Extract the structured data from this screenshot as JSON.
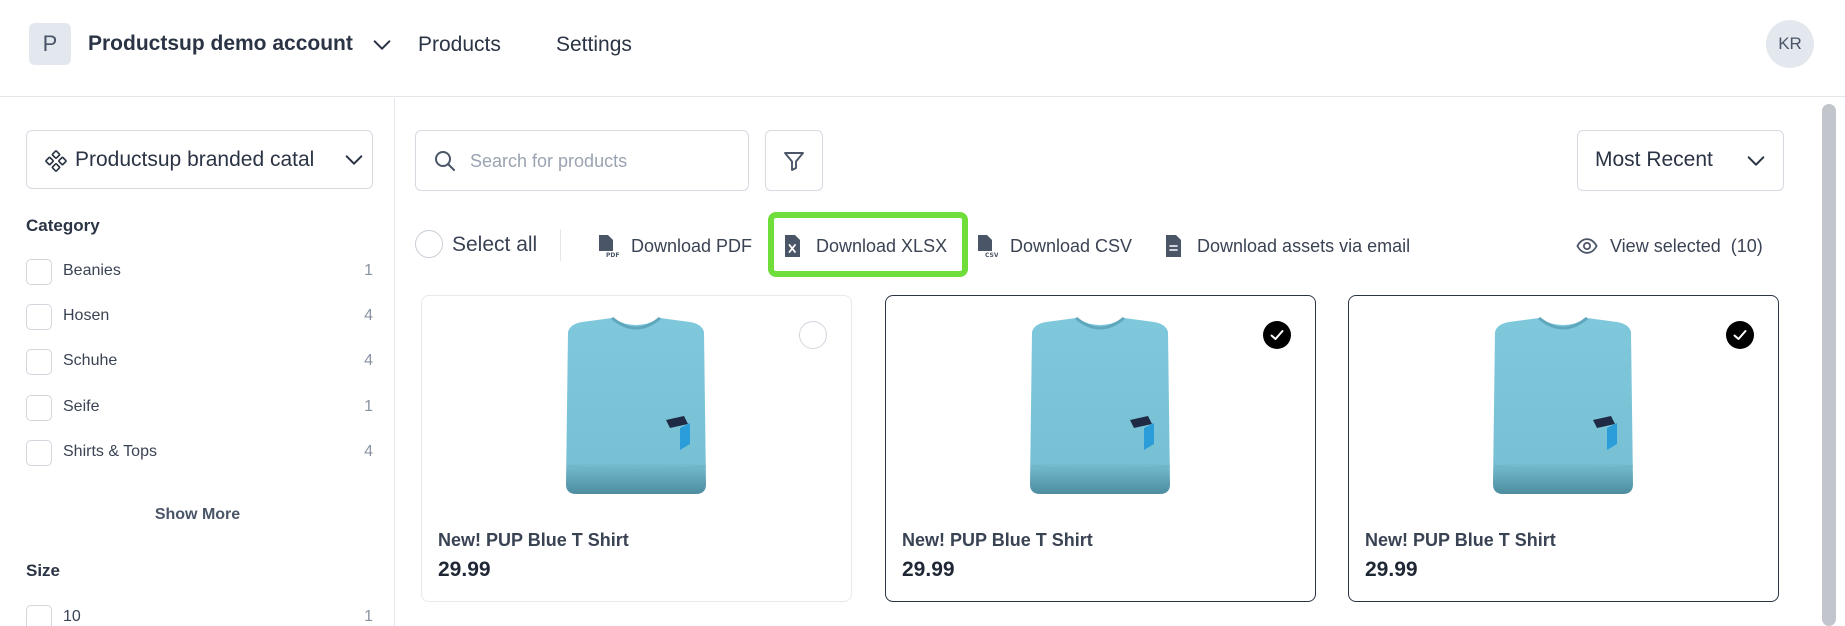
{
  "header": {
    "account_initial": "P",
    "account_name": "Productsup demo account",
    "nav": [
      "Products",
      "Settings"
    ],
    "user_initials": "KR"
  },
  "sidebar": {
    "catalog": "Productsup branded catal",
    "category_heading": "Category",
    "categories": [
      {
        "label": "Beanies",
        "count": "1"
      },
      {
        "label": "Hosen",
        "count": "4"
      },
      {
        "label": "Schuhe",
        "count": "4"
      },
      {
        "label": "Seife",
        "count": "1"
      },
      {
        "label": "Shirts & Tops",
        "count": "4"
      }
    ],
    "show_more": "Show More",
    "size_heading": "Size",
    "sizes": [
      {
        "label": "10",
        "count": "1"
      }
    ]
  },
  "search": {
    "placeholder": "Search for products"
  },
  "sort": {
    "selected": "Most Recent"
  },
  "toolbar": {
    "select_all": "Select all",
    "download_pdf": "Download PDF",
    "download_xlsx": "Download XLSX",
    "download_csv": "Download CSV",
    "download_assets": "Download assets via email",
    "view_selected": "View selected",
    "selected_count": "(10)"
  },
  "products": [
    {
      "name": "New! PUP Blue T Shirt",
      "price": "29.99",
      "selected": false
    },
    {
      "name": "New! PUP Blue T Shirt",
      "price": "29.99",
      "selected": true
    },
    {
      "name": "New! PUP Blue T Shirt",
      "price": "29.99",
      "selected": true
    }
  ],
  "colors": {
    "highlight": "#6fdd3a",
    "shirt": "#79c3d8",
    "text": "#2b3445"
  }
}
